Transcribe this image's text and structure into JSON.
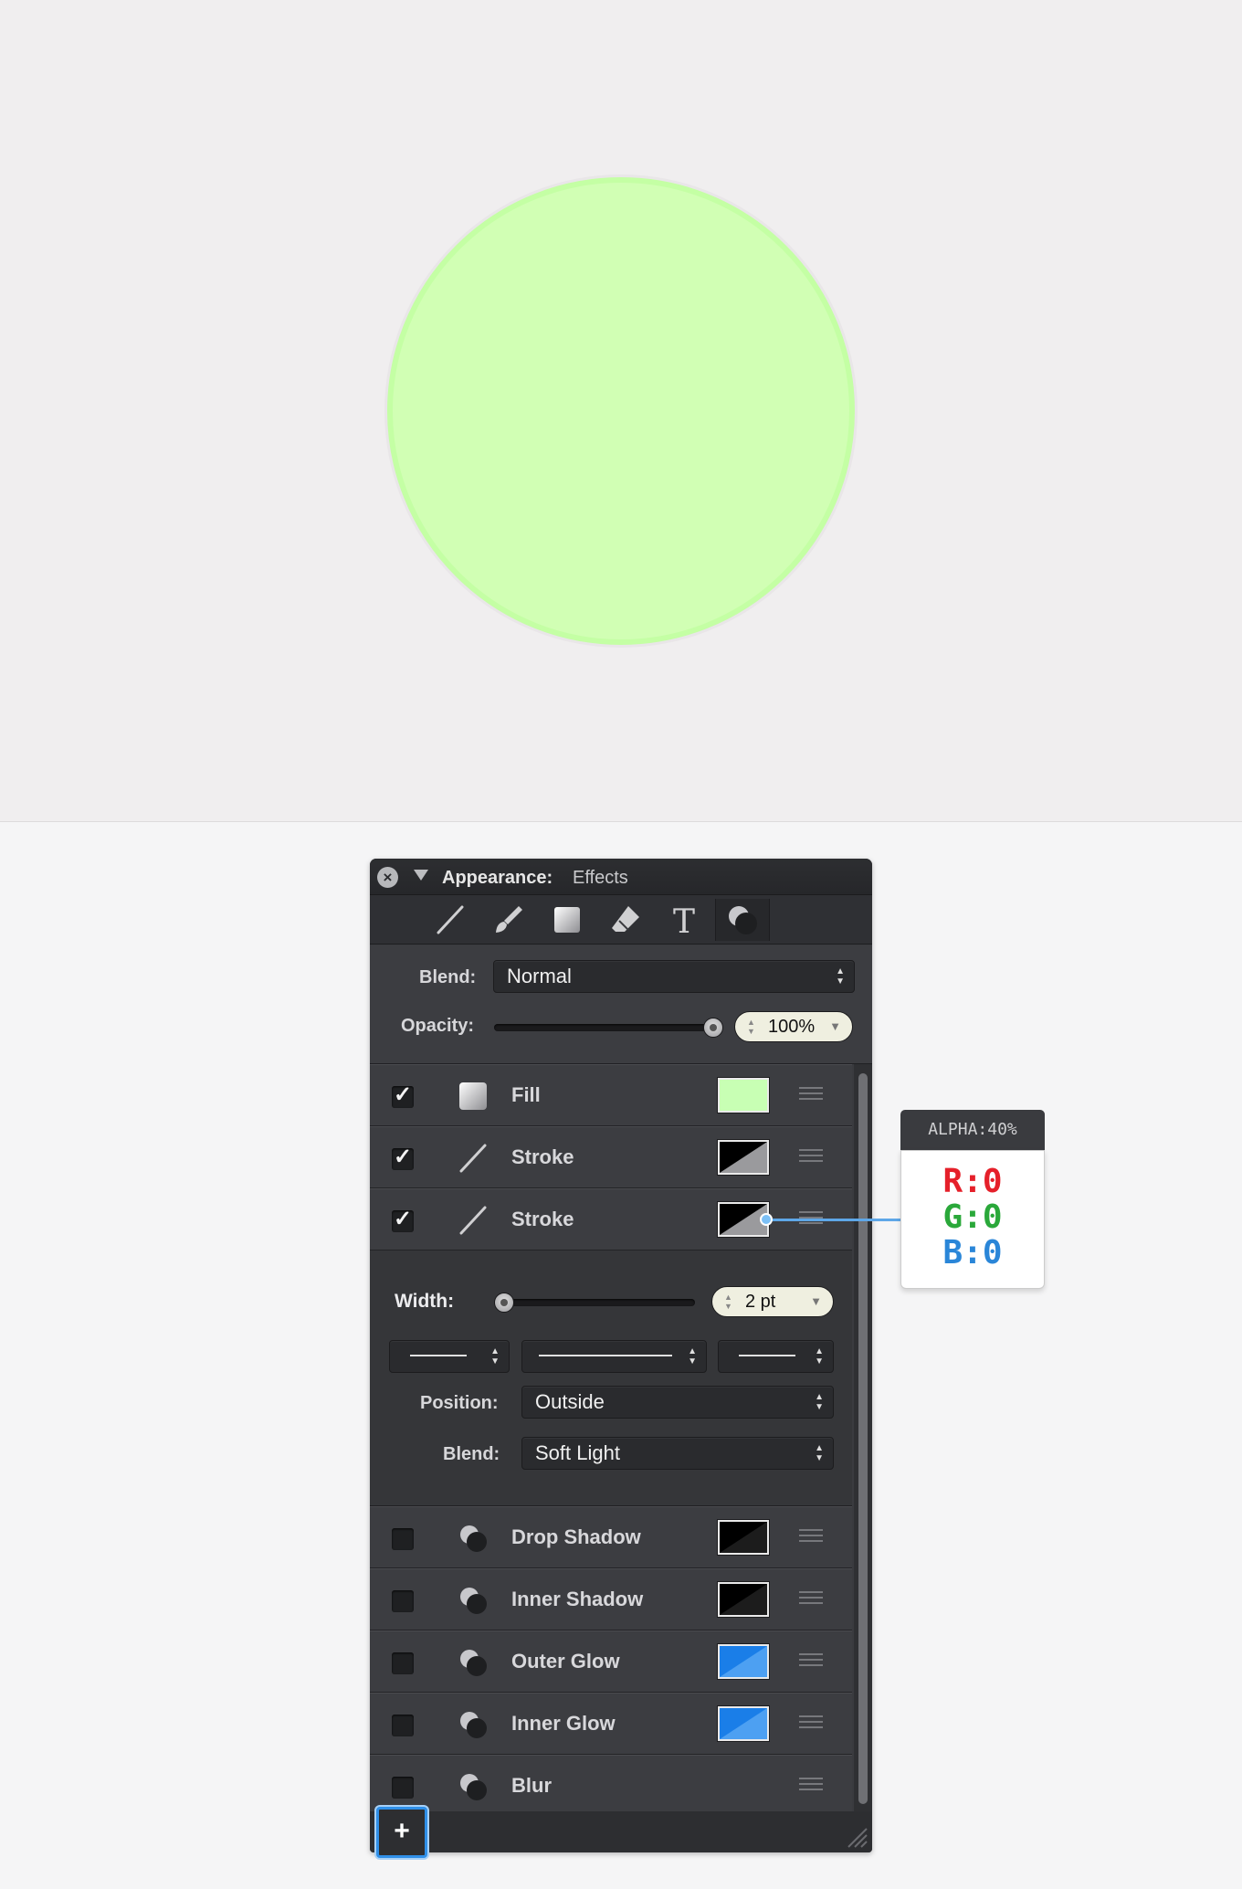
{
  "canvas": {
    "circle_fill": "#d1ffb4",
    "circle_stroke": "#c4ffa4"
  },
  "panel": {
    "title_label": "Appearance:",
    "title_value": "Effects",
    "close_icon": "close-icon",
    "tools": [
      "stroke-tool-icon",
      "brush-tool-icon",
      "fill-tool-icon",
      "eraser-tool-icon",
      "text-tool-icon",
      "effects-tool-icon"
    ],
    "blend_label": "Blend:",
    "blend_value": "Normal",
    "opacity_label": "Opacity:",
    "opacity_value": "100%",
    "opacity_fraction": 1.0
  },
  "rows": [
    {
      "label": "Fill",
      "checked": true,
      "icon": "fill-icon",
      "swatch": "#c8ffb4"
    },
    {
      "label": "Stroke",
      "checked": true,
      "icon": "stroke-icon",
      "swatch": "black"
    },
    {
      "label": "Stroke",
      "checked": true,
      "icon": "stroke-icon",
      "swatch": "black"
    }
  ],
  "stroke_detail": {
    "width_label": "Width:",
    "width_value": "2 pt",
    "width_fraction": 0.0,
    "position_label": "Position:",
    "position_value": "Outside",
    "blend_label": "Blend:",
    "blend_value": "Soft Light"
  },
  "effects": [
    {
      "label": "Drop Shadow",
      "checked": false,
      "swatch": "black"
    },
    {
      "label": "Inner Shadow",
      "checked": false,
      "swatch": "black"
    },
    {
      "label": "Outer Glow",
      "checked": false,
      "swatch": "#1a7ee8"
    },
    {
      "label": "Inner Glow",
      "checked": false,
      "swatch": "#1a7ee8"
    },
    {
      "label": "Blur",
      "checked": false,
      "swatch": null
    }
  ],
  "add_button_label": "+",
  "callout": {
    "alpha": "ALPHA:40%",
    "r": "R:0",
    "g": "G:0",
    "b": "B:0"
  }
}
